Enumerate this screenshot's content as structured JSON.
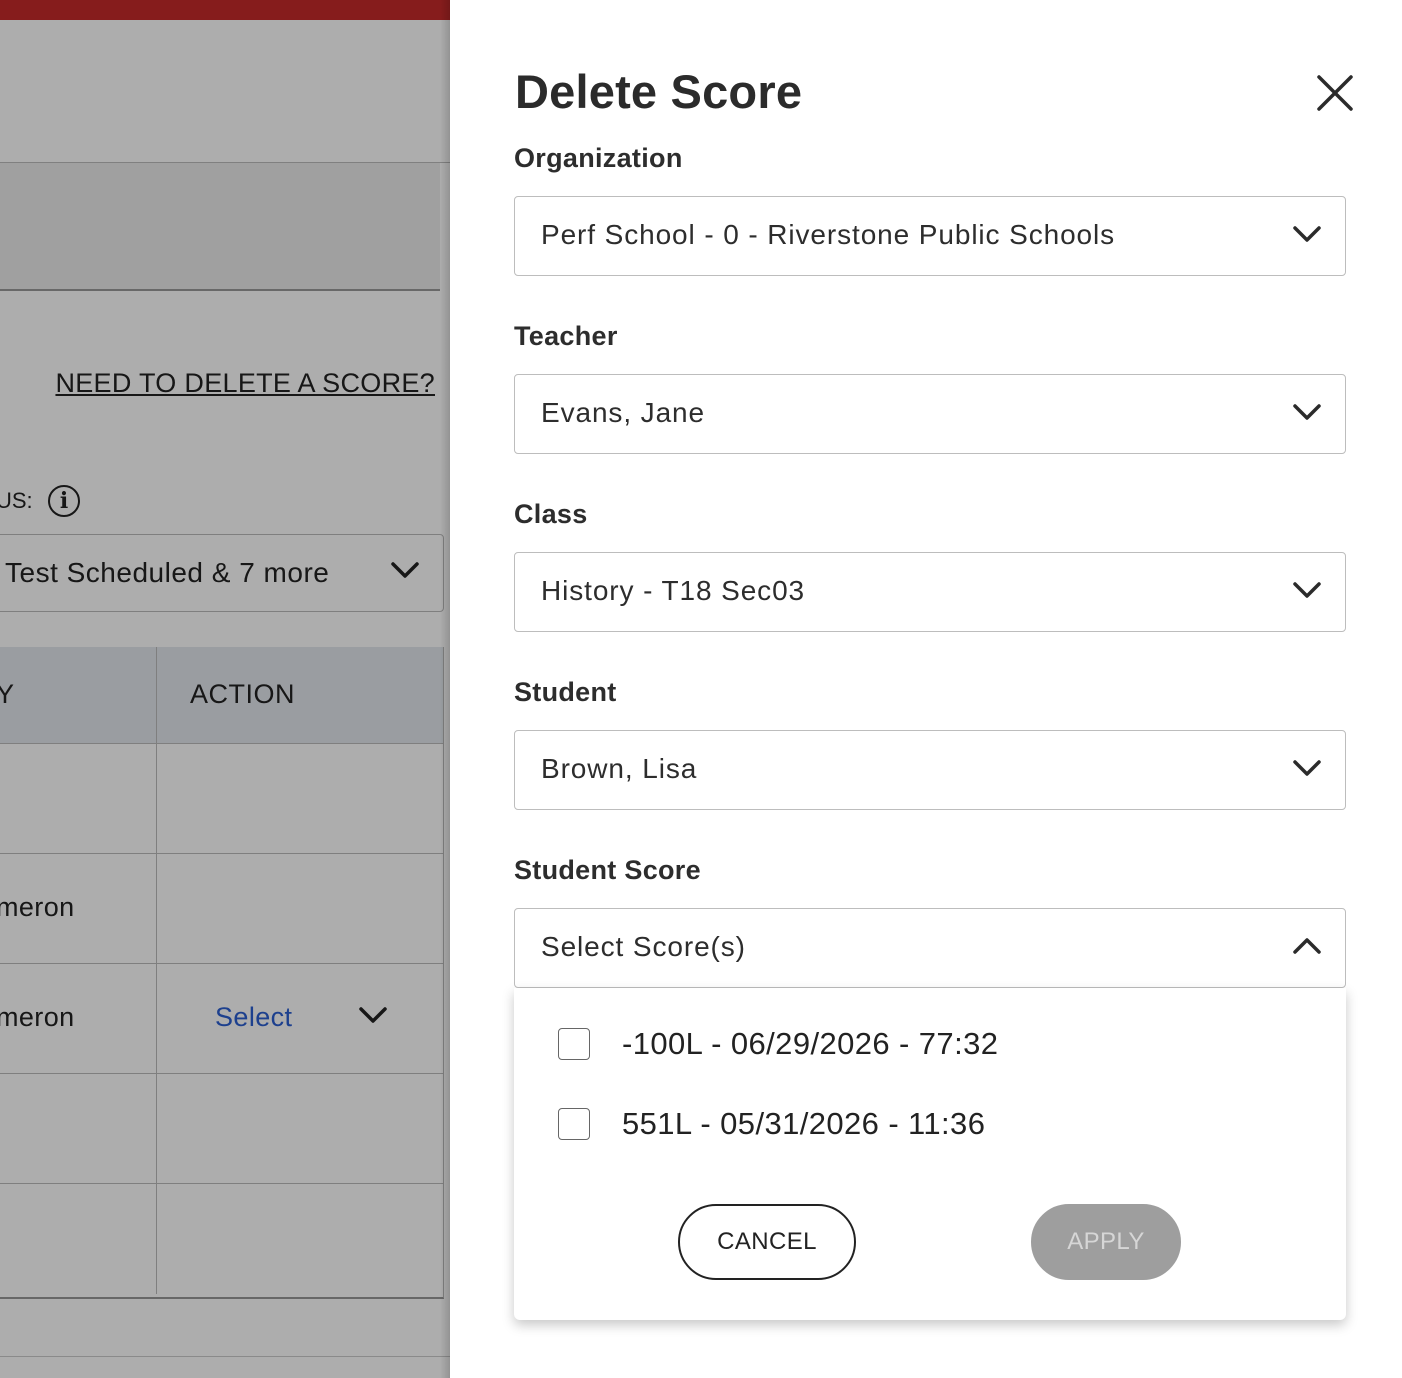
{
  "background": {
    "delete_link": "NEED TO DELETE A SCORE?",
    "status_label": "US:",
    "status_select_value": "Test Scheduled & 7 more",
    "table": {
      "headers": [
        "Y",
        "ACTION"
      ],
      "rows": [
        {
          "name": "",
          "action": ""
        },
        {
          "name": "meron",
          "action": ""
        },
        {
          "name": "meron",
          "action": "Select"
        },
        {
          "name": "",
          "action": ""
        },
        {
          "name": "",
          "action": ""
        }
      ]
    }
  },
  "drawer": {
    "title": "Delete Score",
    "fields": {
      "organization": {
        "label": "Organization",
        "value": "Perf School - 0 - Riverstone Public Schools"
      },
      "teacher": {
        "label": "Teacher",
        "value": "Evans, Jane"
      },
      "class": {
        "label": "Class",
        "value": "History - T18 Sec03"
      },
      "student": {
        "label": "Student",
        "value": "Brown, Lisa"
      },
      "student_score": {
        "label": "Student Score",
        "value": "Select Score(s)"
      }
    },
    "score_options": [
      {
        "label": "-100L - 06/29/2026 - 77:32",
        "checked": false
      },
      {
        "label": "551L - 05/31/2026 - 11:36",
        "checked": false
      }
    ],
    "cancel_label": "CANCEL",
    "apply_label": "APPLY"
  },
  "colors": {
    "brand_red": "#c62a2a",
    "link_blue": "#2b5fd1",
    "disabled_gray": "#9e9e9e"
  }
}
